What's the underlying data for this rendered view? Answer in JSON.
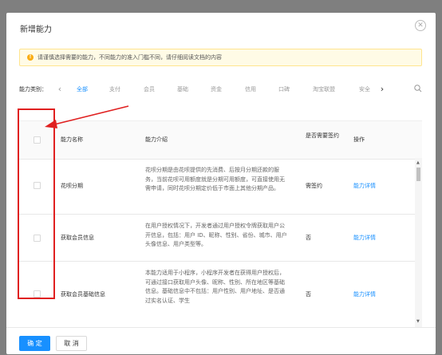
{
  "dialog": {
    "title": "新增能力",
    "close_glyph": "✕"
  },
  "notice": {
    "icon_glyph": "!",
    "text": "请谨慎选择需要的能力，不同能力的准入门槛不同，请仔细阅读文档的内容"
  },
  "categories": {
    "label": "能力类别：",
    "prev_glyph": "‹",
    "next_glyph": "›",
    "tabs": [
      {
        "label": "全部",
        "active": true
      },
      {
        "label": "支付"
      },
      {
        "label": "会员"
      },
      {
        "label": "基础"
      },
      {
        "label": "资金"
      },
      {
        "label": "信用"
      },
      {
        "label": "口碑"
      },
      {
        "label": "淘宝联盟"
      },
      {
        "label": "安全"
      }
    ]
  },
  "table": {
    "headers": {
      "name": "能力名称",
      "desc": "能力介绍",
      "sign": "是否需要签约",
      "op": "操作"
    },
    "rows": [
      {
        "name": "花呗分期",
        "desc": "花呗分期是由花呗提供的先消费、后按月分期还款的服务，当前花呗可用额度就是分期可用额度，可直接使用无需申请，同时花呗分期定价低于市面上其他分期产品。",
        "sign": "需签约",
        "op": "能力详情"
      },
      {
        "name": "获取会员信息",
        "desc": "在用户授权情况下，开发者通过用户授权令牌获取用户公开信息，包括：用户 ID、昵称、性别、省份、城市、用户头像信息、用户类型等。",
        "sign": "否",
        "op": "能力详情"
      },
      {
        "name": "获取会员基础信息",
        "desc": "本能力适用于小程序，小程序开发者在获得用户授权后，可通过接口获取用户头像、昵称、性别、所在地区等基础信息。基础信息中不包括：用户性别、用户地址、是否通过实名认证、学生",
        "sign": "否",
        "op": "能力详情"
      }
    ],
    "scroll_up_glyph": "▲",
    "scroll_down_glyph": "▼"
  },
  "footer": {
    "ok_label": "确 定",
    "cancel_label": "取 消"
  },
  "colors": {
    "accent": "#1890ff",
    "annotation": "#e02020",
    "notice_bg": "#fffbe6"
  }
}
